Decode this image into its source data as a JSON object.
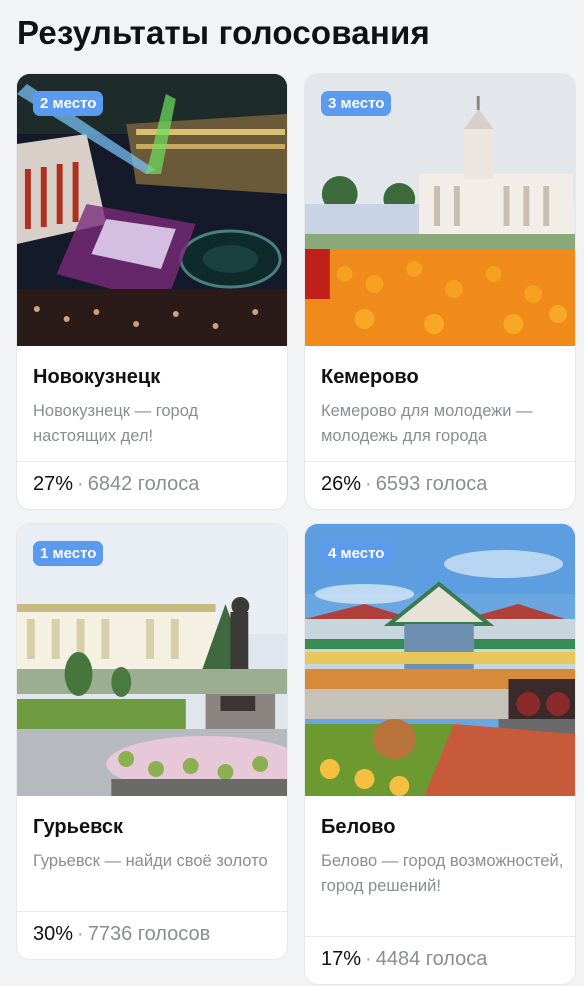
{
  "page": {
    "title": "Результаты голосования"
  },
  "cards": [
    {
      "badge": "2 место",
      "name": "Новокузнецк",
      "description": "Новокузнецк — город настоящих дел!",
      "percent": "27%",
      "separator": "·",
      "votes": "6842 голоса"
    },
    {
      "badge": "3 место",
      "name": "Кемерово",
      "description": "Кемерово для молодежи — молодежь для города",
      "percent": "26%",
      "separator": "·",
      "votes": "6593 голоса"
    },
    {
      "badge": "1 место",
      "name": "Гурьевск",
      "description": "Гурьевск — найди своё золото",
      "percent": "30%",
      "separator": "·",
      "votes": "7736 голосов"
    },
    {
      "badge": "4 место",
      "name": "Белово",
      "description": "Белово — город возможностей, город решений!",
      "percent": "17%",
      "separator": "·",
      "votes": "4484 голоса"
    }
  ],
  "colors": {
    "badge": "#5a9bf0",
    "text_primary": "#111111",
    "text_secondary": "#8a8d92",
    "background": "#f2f3f5"
  }
}
